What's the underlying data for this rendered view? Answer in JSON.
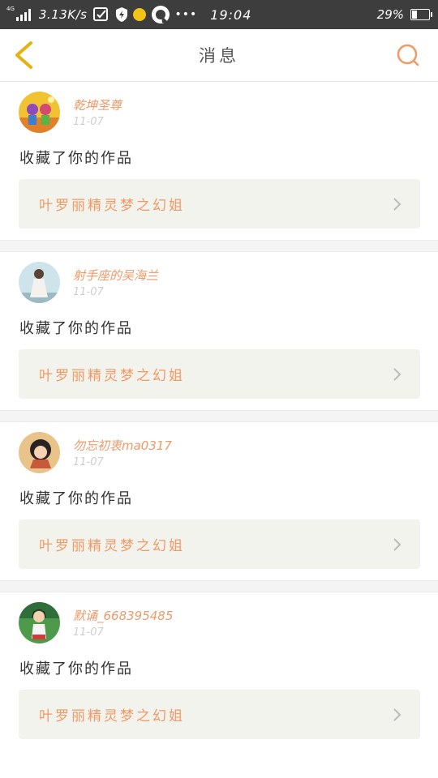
{
  "status_bar": {
    "network": "4G",
    "speed": "3.13K/s",
    "time": "19:04",
    "battery": "29%",
    "battery_level": 0.29
  },
  "header": {
    "title": "消息"
  },
  "messages": [
    {
      "username": "乾坤圣尊",
      "date": "11-07",
      "action": "收藏了你的作品",
      "work_title": "叶罗丽精灵梦之幻姐"
    },
    {
      "username": "射手座的吴海兰",
      "date": "11-07",
      "action": "收藏了你的作品",
      "work_title": "叶罗丽精灵梦之幻姐"
    },
    {
      "username": "勿忘初衷ma0317",
      "date": "11-07",
      "action": "收藏了你的作品",
      "work_title": "叶罗丽精灵梦之幻姐"
    },
    {
      "username": "默诵_668395485",
      "date": "11-07",
      "action": "收藏了你的作品",
      "work_title": "叶罗丽精灵梦之幻姐"
    }
  ],
  "colors": {
    "accent": "#ef9a66",
    "status_bar": "#3d3d3d",
    "card_bg": "#f3f3ed"
  }
}
